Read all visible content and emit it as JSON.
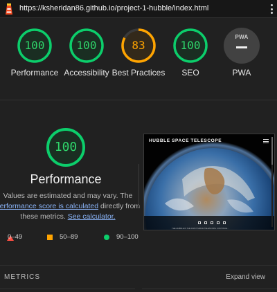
{
  "topbar": {
    "url": "https://ksheridan86.github.io/project-1-hubble/index.html"
  },
  "gauges": [
    {
      "label": "Performance",
      "score": "100",
      "fraction": 1.0,
      "color": "#0cce6b"
    },
    {
      "label": "Accessibility",
      "score": "100",
      "fraction": 1.0,
      "color": "#0cce6b"
    },
    {
      "label": "Best Practices",
      "score": "83",
      "fraction": 0.83,
      "color": "#ffa400"
    },
    {
      "label": "SEO",
      "score": "100",
      "fraction": 1.0,
      "color": "#0cce6b"
    },
    {
      "label": "PWA",
      "badge": "PWA"
    }
  ],
  "performance": {
    "score": "100",
    "title": "Performance",
    "desc_prefix": "Values are estimated and may vary. The ",
    "desc_link": "performance score is calculated",
    "desc_middle": " directly from these metrics. ",
    "desc_link2": "See calculator."
  },
  "legend": {
    "fail": "0–49",
    "average": "50–89",
    "pass": "90–100"
  },
  "screenshot": {
    "title": "HUBBLE SPACE TELESCOPE",
    "footer_text": "THE HUBBLE IS THE FIRST SPACE TELESCOPE. CONTINUE..."
  },
  "metrics": {
    "header": "METRICS",
    "expand": "Expand view"
  },
  "colors": {
    "pass": "#0cce6b",
    "average": "#ffa400",
    "fail": "#ff4e42",
    "link": "#8ab4f8"
  }
}
